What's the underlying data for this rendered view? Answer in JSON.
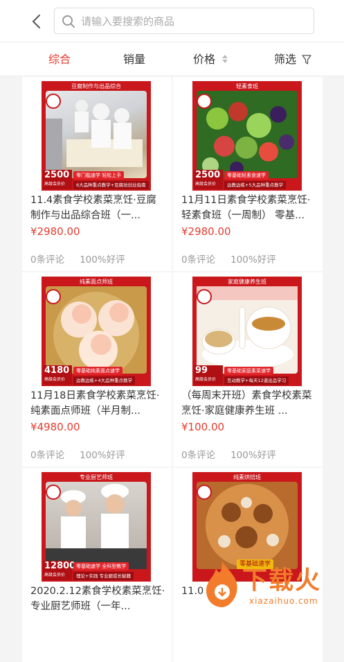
{
  "search": {
    "placeholder": "请输入要搜索的商品"
  },
  "sortbar": {
    "items": [
      {
        "label": "综合",
        "active": true
      },
      {
        "label": "销量"
      },
      {
        "label": "价格"
      },
      {
        "label": "筛选"
      }
    ]
  },
  "products": [
    {
      "title": "11.4素食学校素菜烹饪·豆腐制作与出品综合班（一...",
      "price": "¥2980.00",
      "reviews": "0条评论",
      "rating": "100%好评",
      "thumb_label": "豆腐制作与出品综合班",
      "thumb_price": "2500",
      "thumb_price_sub": "高级会员价",
      "thumb_badge": "零门槛速学  轻松上手",
      "thumb_strip": "6大品种重点教学+豆腐坊创业指南"
    },
    {
      "title": "11月11日素食学校素菜烹饪·轻素食班（一周制） 零基...",
      "price": "¥2980.00",
      "reviews": "0条评论",
      "rating": "100%好评",
      "thumb_label": "轻素食班",
      "thumb_price": "2500",
      "thumb_price_sub": "高级会员价",
      "thumb_badge": "零基础轻素食速学",
      "thumb_strip": "边教边练+5大品种重点教学"
    },
    {
      "title": "11月18日素食学校素菜烹饪·纯素面点师班（半月制...",
      "price": "¥4980.00",
      "reviews": "0条评论",
      "rating": "100%好评",
      "thumb_label": "纯素面点师班",
      "thumb_price": "4180",
      "thumb_price_sub": "高级会员价",
      "thumb_badge": "零基础纯素面点速学",
      "thumb_strip": "边教边练+4大品种重点教学"
    },
    {
      "title": "（每周末开班）素食学校素菜烹饪·家庭健康养生班 ...",
      "price": "¥100.00",
      "reviews": "0条评论",
      "rating": "100%好评",
      "thumb_label": "家庭健康养生班",
      "thumb_price": "99",
      "thumb_price_sub": "高级会员价",
      "thumb_badge": "零基础家庭素菜速学",
      "thumb_strip": "互动教学+每天12道出品学习"
    },
    {
      "title": "2020.2.12素食学校素菜烹饪·专业厨艺师班（一年...",
      "price": "",
      "reviews": "",
      "rating": "",
      "thumb_label": "专业厨艺师班",
      "thumb_price": "12800",
      "thumb_price_sub": "高级会员价",
      "thumb_badge": "零基础速学  全科型教学",
      "thumb_strip": "理论+实践  专业厨成长秘籍"
    },
    {
      "title": "11.0 素烘...",
      "price": "",
      "reviews": "",
      "rating": "",
      "thumb_label": "纯素烘焙班",
      "thumb_price": "",
      "thumb_price_sub": "",
      "thumb_badge": "零基础速学",
      "thumb_strip": ""
    }
  ],
  "watermark": {
    "text": "下载火",
    "sub": "xiazaihuo.com"
  },
  "colors": {
    "accent": "#e53b2f",
    "brand_red": "#c9171c",
    "watermark": "#f27c2b"
  }
}
